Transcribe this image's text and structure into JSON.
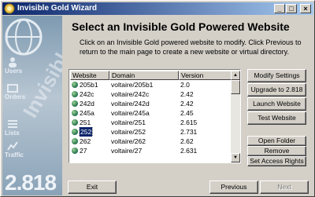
{
  "window": {
    "title": "Invisible Gold Wizard"
  },
  "titlebar_buttons": {
    "minimize": "_",
    "maximize": "□",
    "close": "×"
  },
  "sidebar": {
    "items": [
      {
        "label": "Users",
        "icon": "users-icon"
      },
      {
        "label": "Orders",
        "icon": "orders-icon"
      },
      {
        "label": "Lists",
        "icon": "lists-icon"
      },
      {
        "label": "Traffic",
        "icon": "traffic-icon"
      }
    ],
    "watermark": "Invisible",
    "version": "2.818"
  },
  "main": {
    "title": "Select an Invisible Gold Powered Website",
    "instructions": "Click on an Invisible Gold powered website to modify.  Click Previous to return to the main page to create a new website or virtual directory."
  },
  "table": {
    "columns": [
      "Website",
      "Domain",
      "Version"
    ],
    "rows": [
      {
        "website": "205b1",
        "domain": "voltaire/205b1",
        "version": "2.0"
      },
      {
        "website": "242c",
        "domain": "voltaire/242c",
        "version": "2.42"
      },
      {
        "website": "242d",
        "domain": "voltaire/242d",
        "version": "2.42"
      },
      {
        "website": "245a",
        "domain": "voltaire/245a",
        "version": "2.45"
      },
      {
        "website": "251",
        "domain": "voltaire/251",
        "version": "2.615"
      },
      {
        "website": "252",
        "domain": "voltaire/252",
        "version": "2.731",
        "selected": true
      },
      {
        "website": "262",
        "domain": "voltaire/262",
        "version": "2.62"
      },
      {
        "website": "27",
        "domain": "voltaire/27",
        "version": "2.631"
      }
    ]
  },
  "actions": {
    "modify_settings": "Modify Settings",
    "upgrade": "Upgrade to 2.818",
    "launch": "Launch Website",
    "test": "Test Website",
    "open_folder": "Open Folder",
    "remove": "Remove",
    "access_rights": "Set Access Rights"
  },
  "nav": {
    "exit": "Exit",
    "previous": "Previous",
    "next": "Next"
  },
  "colors": {
    "titlebar_start": "#0a246a",
    "titlebar_end": "#a6caf0",
    "selection": "#0a246a"
  }
}
